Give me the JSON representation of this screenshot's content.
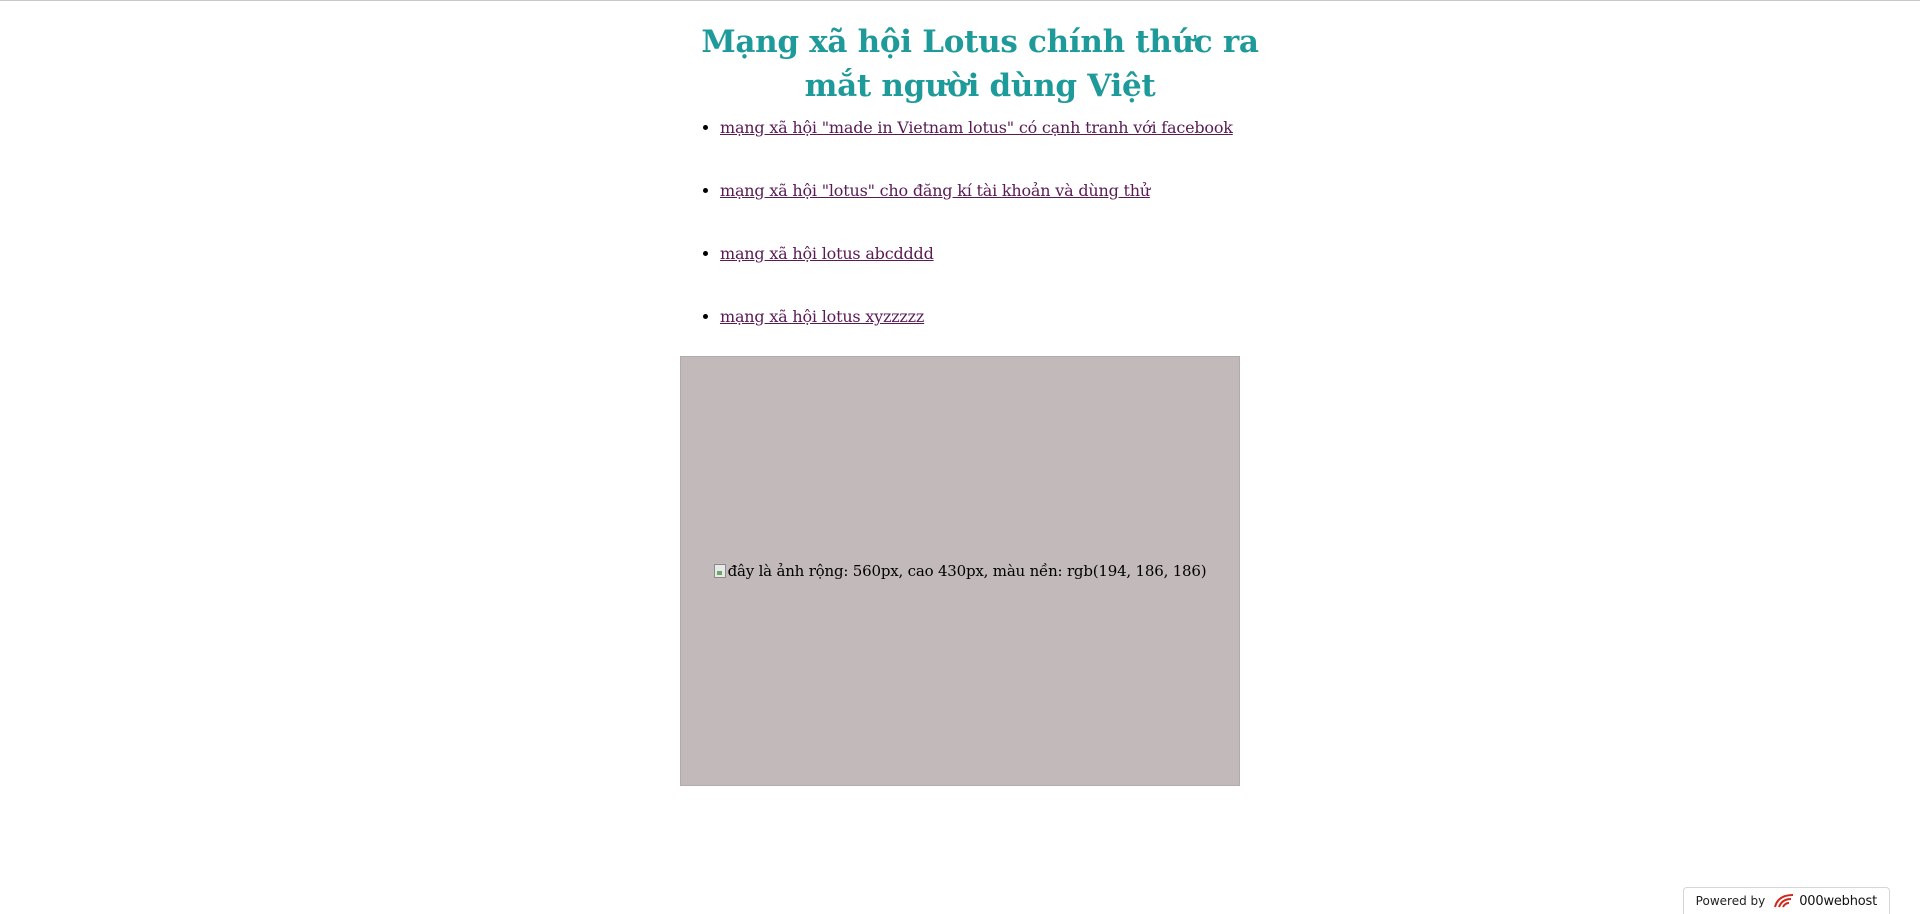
{
  "page": {
    "title": "Mạng xã hội Lotus chính thức ra mắt người dùng Việt",
    "title_color": "#1f9a9a",
    "link_color": "#5a1a55"
  },
  "articles": [
    {
      "label": "mạng xã hội \"made in Vietnam lotus\" có cạnh tranh với facebook"
    },
    {
      "label": "mạng xã hội \"lotus\" cho đăng kí tài khoản và dùng thử"
    },
    {
      "label": "mạng xã hội lotus abcdddd"
    },
    {
      "label": "mạng xã hội lotus xyzzzzz"
    }
  ],
  "image": {
    "alt": "đây là ảnh rộng: 560px, cao 430px, màu nền: rgb(194, 186, 186)",
    "background": "#c2baba",
    "icon": "broken-image-icon"
  },
  "footer_badge": {
    "powered_by": "Powered by",
    "brand": "000webhost",
    "logo_icon": "000webhost-logo-icon"
  }
}
